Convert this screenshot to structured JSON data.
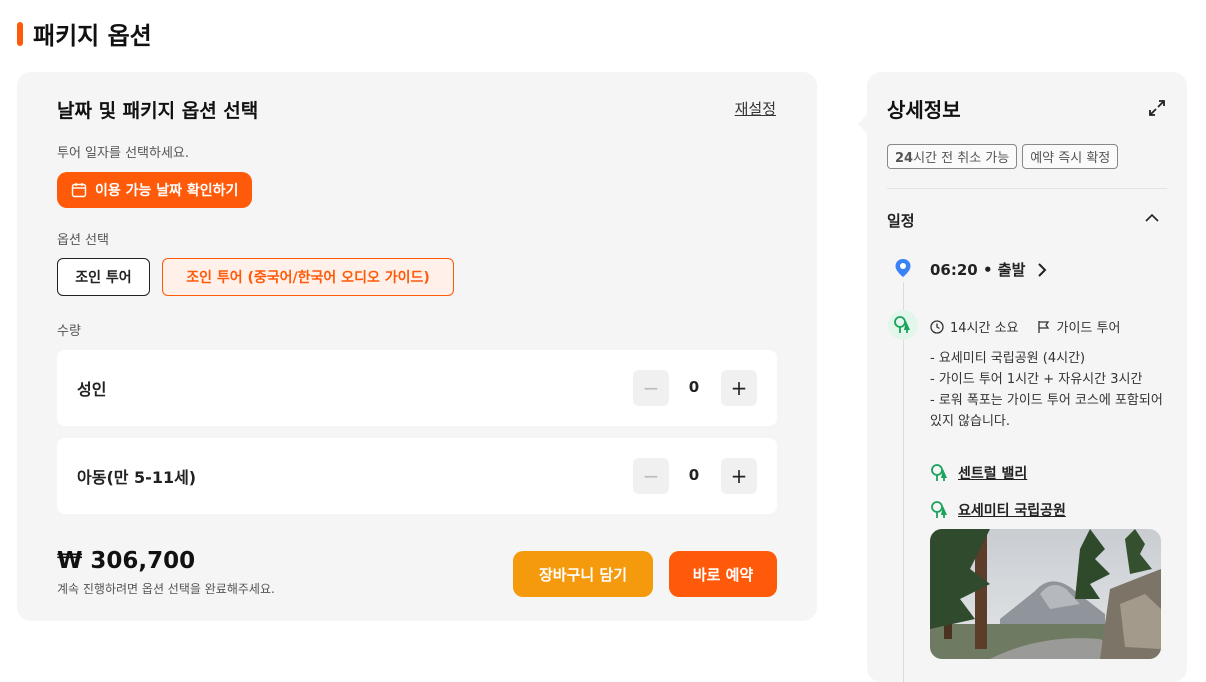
{
  "page_title": "패키지 옵션",
  "left": {
    "title": "날짜 및 패키지 옵션 선택",
    "reset_label": "재설정",
    "date_hint": "투어 일자를 선택하세요.",
    "date_button": "이용 가능 날짜 확인하기",
    "option_label": "옵션 선택",
    "options": [
      "조인 투어",
      "조인 투어 (중국어/한국어 오디오 가이드)"
    ],
    "quantity_label": "수량",
    "quantities": [
      {
        "name": "성인",
        "value": "0",
        "minus": "−",
        "plus": "+"
      },
      {
        "name": "아동(만 5-11세)",
        "value": "0",
        "minus": "−",
        "plus": "+"
      }
    ],
    "price": "₩ 306,700",
    "price_hint": "계속 진행하려면 옵션 선택을 완료해주세요.",
    "cart_button": "장바구니 담기",
    "book_button": "바로 예약"
  },
  "right": {
    "title": "상세정보",
    "tags": [
      {
        "bold": "24",
        "rest": "시간 전 취소 가능"
      },
      {
        "bold": "",
        "rest": "예약 즉시 확정"
      }
    ],
    "schedule_label": "일정",
    "departure": "06:20 • 출발",
    "duration": "14시간 소요",
    "tour_type": "가이드 투어",
    "description": [
      "- 요세미티 국립공원 (4시간)",
      "- 가이드 투어 1시간 + 자유시간 3시간",
      "- 로워 폭포는 가이드 투어 코스에 포함되어 있지 않습니다."
    ],
    "poi": [
      "센트럴 밸리",
      "요세미티 국립공원"
    ]
  },
  "colors": {
    "accent": "#ff5a0a",
    "cart": "#f59a0c",
    "card_bg": "#f5f5f5",
    "pin_blue": "#3b82f6",
    "place_green": "#1aa35b"
  }
}
